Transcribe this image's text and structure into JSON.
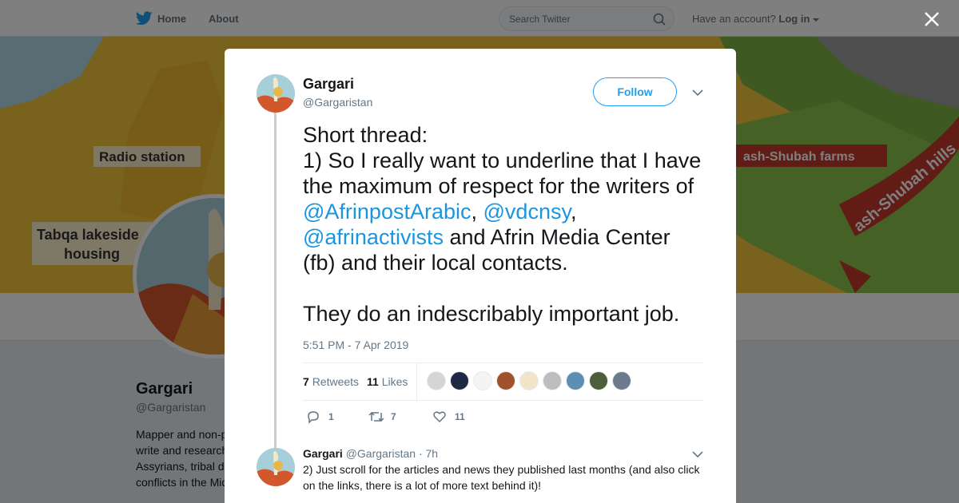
{
  "nav": {
    "home_label": "Home",
    "about_label": "About",
    "search_placeholder": "Search Twitter",
    "have_account": "Have an account?",
    "login_label": "Log in"
  },
  "cover": {
    "labels": [
      "Radio station",
      "Tabqa lakeside housing",
      "ash-Shubah farms",
      "ash-Shubah hills"
    ]
  },
  "profile": {
    "name": "Gargari",
    "handle": "@Gargaristan",
    "bio_lines": [
      "Mapper and non-p",
      "write and research",
      "Assyrians, tribal d",
      "conflicts in the Mid"
    ]
  },
  "tweet": {
    "author_name": "Gargari",
    "author_handle": "@Gargaristan",
    "follow_label": "Follow",
    "text_1": "Short thread:",
    "text_2a": "1) So I really want to underline that I have the maximum of respect for the writers of ",
    "mention_1": "@AfrinpostArabic",
    "comma_1": ", ",
    "mention_2": "@vdcnsy",
    "comma_2": ",",
    "mention_3": "@afrinactivists",
    "text_2b": " and Afrin Media Center (fb) and their local contacts.",
    "text_3": "They do an indescribably important job.",
    "timestamp": "5:51 PM - 7 Apr 2019",
    "retweets_count": "7",
    "retweets_label": "Retweets",
    "likes_count": "11",
    "likes_label": "Likes",
    "replies": "1",
    "retweets": "7",
    "likes": "11"
  },
  "reply_tweet": {
    "author_name": "Gargari",
    "author_handle": "@Gargaristan",
    "time": "· 7h",
    "text": "2) Just scroll for the articles and news they published last months (and also click on the links, there is a lot of more text behind it)!"
  },
  "colors": {
    "accent": "#1da1f2",
    "link": "#1b95e0",
    "muted": "#657786",
    "map_yellow": "#f2c53d",
    "map_green": "#7cb342",
    "map_red": "#c0392b"
  },
  "icons": [
    "twitter-bird-icon",
    "home-icon",
    "search-icon",
    "close-icon",
    "chevron-down-icon",
    "reply-icon",
    "retweet-icon",
    "heart-icon"
  ]
}
